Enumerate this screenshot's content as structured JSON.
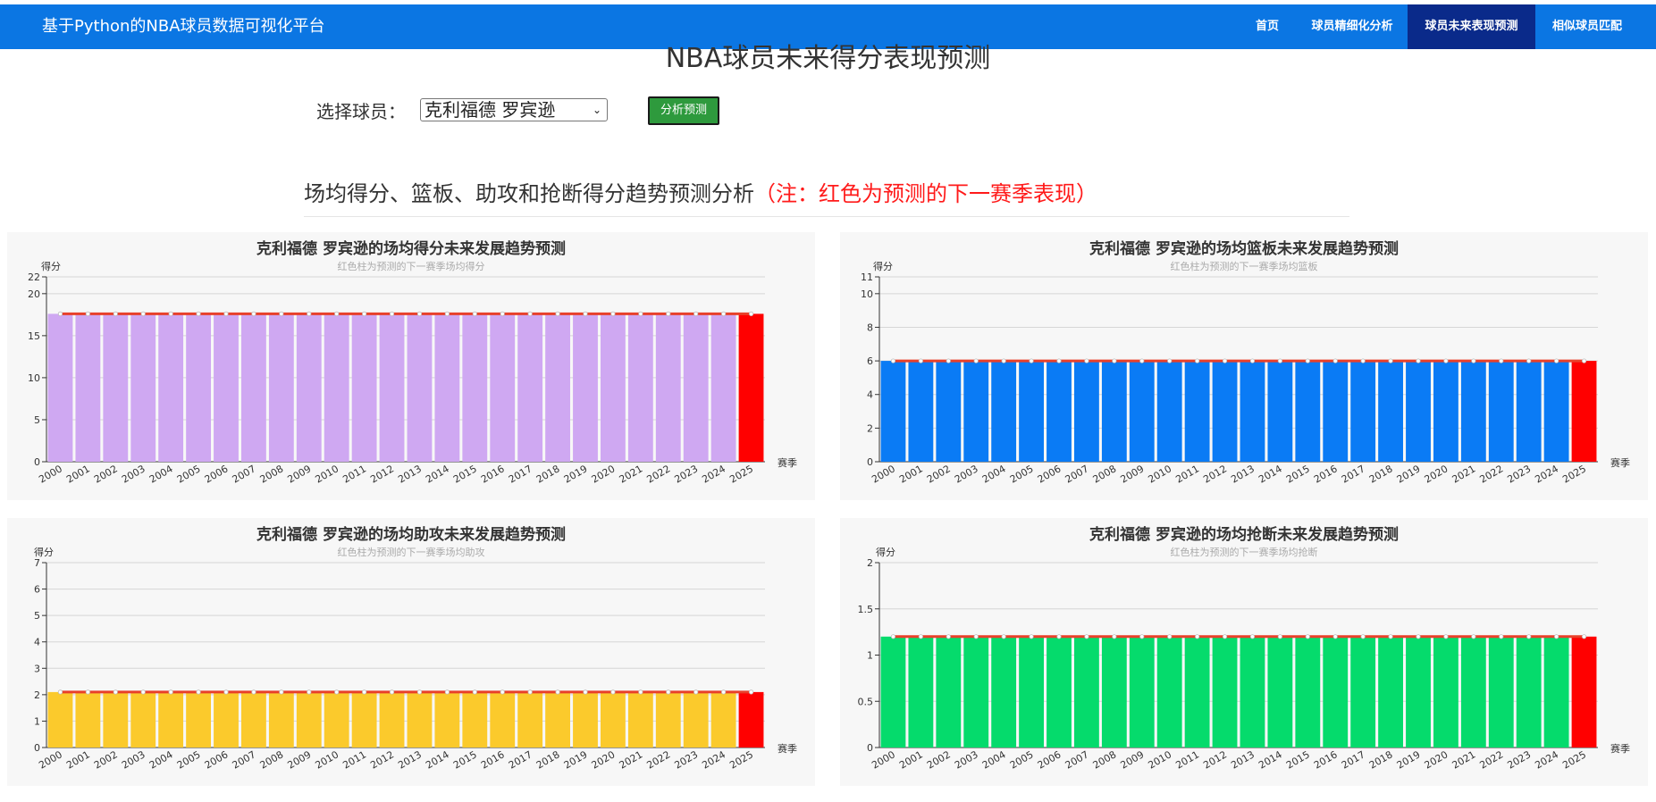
{
  "nav": {
    "brand": "基于Python的NBA球员数据可视化平台",
    "items": [
      {
        "label": "首页",
        "active": false
      },
      {
        "label": "球员精细化分析",
        "active": false
      },
      {
        "label": "球员未来表现预测",
        "active": true
      },
      {
        "label": "相似球员匹配",
        "active": false
      }
    ]
  },
  "page": {
    "title": "NBA球员未来得分表现预测",
    "select_label": "选择球员：",
    "selected_player": "克利福德 罗宾逊",
    "analyze_button": "分析预测",
    "section_heading": "场均得分、篮板、助攻和抢断得分趋势预测分析",
    "section_note": "（注：红色为预测的下一赛季表现）"
  },
  "colors": {
    "nav": "#0b76e3",
    "nav_active": "#0a2a8a",
    "button": "#2e9a3d",
    "prediction_bar": "#ff0000",
    "trend_line": "#e8402a"
  },
  "chart_data": [
    {
      "type": "bar",
      "title": "克利福德 罗宾逊的场均得分未来发展趋势预测",
      "subtitle": "红色柱为预测的下一赛季场均得分",
      "ylabel": "得分",
      "xlabel": "赛季",
      "categories": [
        "2000",
        "2001",
        "2002",
        "2003",
        "2004",
        "2005",
        "2006",
        "2007",
        "2008",
        "2009",
        "2010",
        "2011",
        "2012",
        "2013",
        "2014",
        "2015",
        "2016",
        "2017",
        "2018",
        "2019",
        "2020",
        "2021",
        "2022",
        "2023",
        "2024",
        "2025"
      ],
      "values": [
        17.6,
        17.6,
        17.6,
        17.6,
        17.6,
        17.6,
        17.6,
        17.6,
        17.6,
        17.6,
        17.6,
        17.6,
        17.6,
        17.6,
        17.6,
        17.6,
        17.6,
        17.6,
        17.6,
        17.6,
        17.6,
        17.6,
        17.6,
        17.6,
        17.6,
        17.6
      ],
      "ylim": [
        0,
        22
      ],
      "yticks": [
        0,
        5,
        10,
        15,
        20,
        22
      ],
      "bar_color": "#cfa8f2",
      "prediction_color": "#ff0000"
    },
    {
      "type": "bar",
      "title": "克利福德 罗宾逊的场均篮板未来发展趋势预测",
      "subtitle": "红色柱为预测的下一赛季场均篮板",
      "ylabel": "得分",
      "xlabel": "赛季",
      "categories": [
        "2000",
        "2001",
        "2002",
        "2003",
        "2004",
        "2005",
        "2006",
        "2007",
        "2008",
        "2009",
        "2010",
        "2011",
        "2012",
        "2013",
        "2014",
        "2015",
        "2016",
        "2017",
        "2018",
        "2019",
        "2020",
        "2021",
        "2022",
        "2023",
        "2024",
        "2025"
      ],
      "values": [
        6,
        6,
        6,
        6,
        6,
        6,
        6,
        6,
        6,
        6,
        6,
        6,
        6,
        6,
        6,
        6,
        6,
        6,
        6,
        6,
        6,
        6,
        6,
        6,
        6,
        6
      ],
      "ylim": [
        0,
        11
      ],
      "yticks": [
        0,
        2,
        4,
        6,
        8,
        10,
        11
      ],
      "bar_color": "#0a7bf5",
      "prediction_color": "#ff0000"
    },
    {
      "type": "bar",
      "title": "克利福德 罗宾逊的场均助攻未来发展趋势预测",
      "subtitle": "红色柱为预测的下一赛季场均助攻",
      "ylabel": "得分",
      "xlabel": "赛季",
      "categories": [
        "2000",
        "2001",
        "2002",
        "2003",
        "2004",
        "2005",
        "2006",
        "2007",
        "2008",
        "2009",
        "2010",
        "2011",
        "2012",
        "2013",
        "2014",
        "2015",
        "2016",
        "2017",
        "2018",
        "2019",
        "2020",
        "2021",
        "2022",
        "2023",
        "2024",
        "2025"
      ],
      "values": [
        2.1,
        2.1,
        2.1,
        2.1,
        2.1,
        2.1,
        2.1,
        2.1,
        2.1,
        2.1,
        2.1,
        2.1,
        2.1,
        2.1,
        2.1,
        2.1,
        2.1,
        2.1,
        2.1,
        2.1,
        2.1,
        2.1,
        2.1,
        2.1,
        2.1,
        2.1
      ],
      "ylim": [
        0,
        7
      ],
      "yticks": [
        0,
        1,
        2,
        3,
        4,
        5,
        6,
        7
      ],
      "bar_color": "#fbca2c",
      "prediction_color": "#ff0000"
    },
    {
      "type": "bar",
      "title": "克利福德 罗宾逊的场均抢断未来发展趋势预测",
      "subtitle": "红色柱为预测的下一赛季场均抢断",
      "ylabel": "得分",
      "xlabel": "赛季",
      "categories": [
        "2000",
        "2001",
        "2002",
        "2003",
        "2004",
        "2005",
        "2006",
        "2007",
        "2008",
        "2009",
        "2010",
        "2011",
        "2012",
        "2013",
        "2014",
        "2015",
        "2016",
        "2017",
        "2018",
        "2019",
        "2020",
        "2021",
        "2022",
        "2023",
        "2024",
        "2025"
      ],
      "values": [
        1.2,
        1.2,
        1.2,
        1.2,
        1.2,
        1.2,
        1.2,
        1.2,
        1.2,
        1.2,
        1.2,
        1.2,
        1.2,
        1.2,
        1.2,
        1.2,
        1.2,
        1.2,
        1.2,
        1.2,
        1.2,
        1.2,
        1.2,
        1.2,
        1.2,
        1.2
      ],
      "ylim": [
        0,
        2
      ],
      "yticks": [
        0,
        0.5,
        1,
        1.5,
        2
      ],
      "bar_color": "#05db6c",
      "prediction_color": "#ff0000"
    }
  ]
}
